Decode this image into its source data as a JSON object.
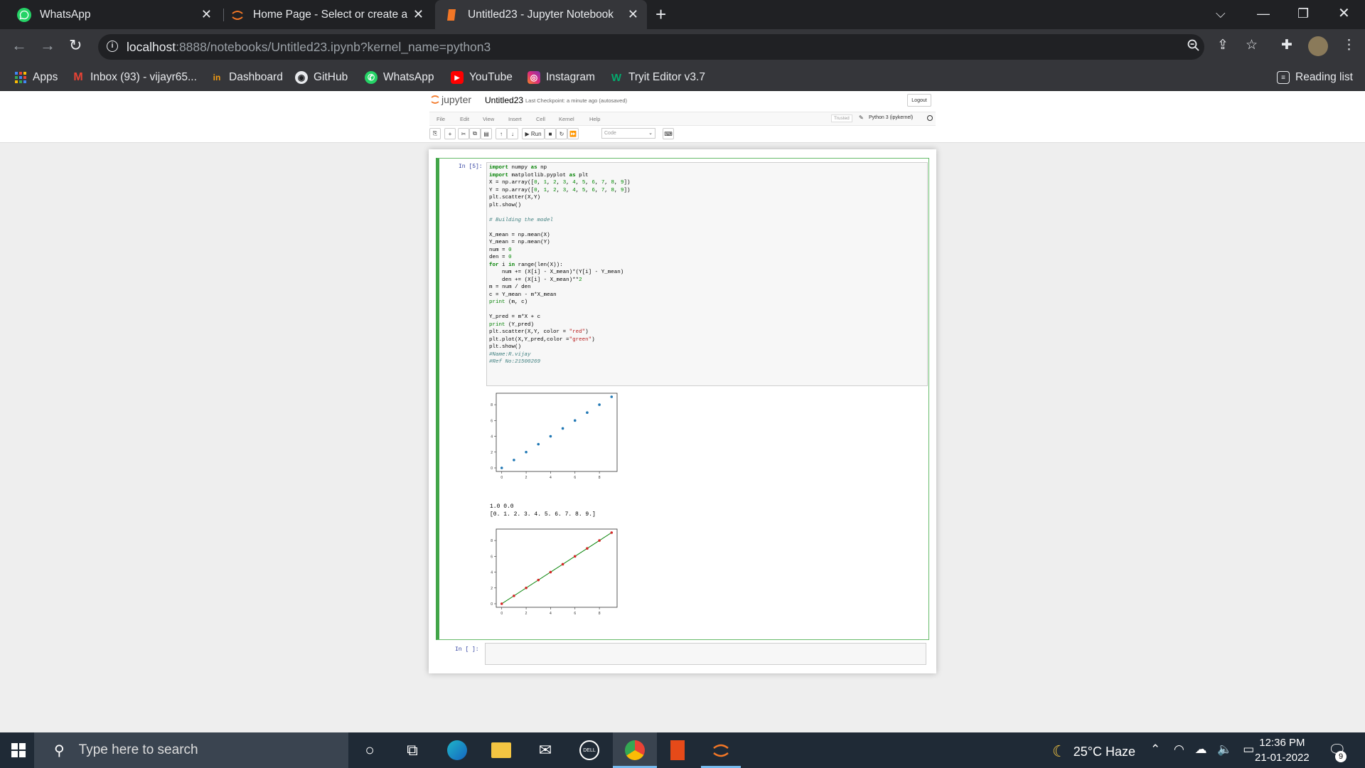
{
  "browser": {
    "tabs": [
      {
        "title": "WhatsApp",
        "icon": "whatsapp-icon"
      },
      {
        "title": "Home Page - Select or create a n",
        "icon": "jupyter-icon"
      },
      {
        "title": "Untitled23 - Jupyter Notebook",
        "icon": "jupyter-notebook-icon"
      }
    ],
    "url_host": "localhost",
    "url_path": ":8888/notebooks/Untitled23.ipynb?kernel_name=python3",
    "bookmarks": [
      {
        "label": "Apps",
        "icon": "apps-grid-icon"
      },
      {
        "label": "Inbox (93) - vijayr65...",
        "icon": "gmail-icon"
      },
      {
        "label": "Dashboard",
        "icon": "dashboard-icon"
      },
      {
        "label": "GitHub",
        "icon": "github-icon"
      },
      {
        "label": "WhatsApp",
        "icon": "whatsapp-icon"
      },
      {
        "label": "YouTube",
        "icon": "youtube-icon"
      },
      {
        "label": "Instagram",
        "icon": "instagram-icon"
      },
      {
        "label": "Tryit Editor v3.7",
        "icon": "w3schools-icon"
      }
    ],
    "reading_list": "Reading list"
  },
  "jupyter": {
    "logo_text": "jupyter",
    "notebook_name": "Untitled23",
    "checkpoint": "Last Checkpoint: a minute ago  (autosaved)",
    "logout": "Logout",
    "menus": [
      "File",
      "Edit",
      "View",
      "Insert",
      "Cell",
      "Kernel",
      "Help"
    ],
    "trusted": "Trusted",
    "kernel": "Python 3 (ipykernel)",
    "run_label": "Run",
    "cell_type": "Code"
  },
  "cells": {
    "prompt1": "In [5]:",
    "code_lines": [
      "import numpy as np",
      "import matplotlib.pyplot as plt",
      "X = np.array([0, 1, 2, 3, 4, 5, 6, 7, 8, 9])",
      "Y = np.array([0, 1, 2, 3, 4, 5, 6, 7, 8, 9])",
      "plt.scatter(X,Y)",
      "plt.show()",
      "",
      "# Building the model",
      "",
      "X_mean = np.mean(X)",
      "Y_mean = np.mean(Y)",
      "num = 0",
      "den = 0",
      "for i in range(len(X)):",
      "    num += (X[i] - X_mean)*(Y[i] - Y_mean)",
      "    den += (X[i] - X_mean)**2",
      "m = num / den",
      "c = Y_mean - m*X_mean",
      "print (m, c)",
      "",
      "Y_pred = m*X + c",
      "print (Y_pred)",
      "plt.scatter(X,Y, color = \"red\")",
      "plt.plot(X,Y_pred,color =\"green\")",
      "plt.show()",
      "#Name:R.vijay",
      "#Ref No:21500269"
    ],
    "print_mc": "1.0 0.0",
    "print_pred": "[0. 1. 2. 3. 4. 5. 6. 7. 8. 9.]",
    "prompt2": "In [ ]:"
  },
  "chart_data": [
    {
      "type": "scatter",
      "x": [
        0,
        1,
        2,
        3,
        4,
        5,
        6,
        7,
        8,
        9
      ],
      "y": [
        0,
        1,
        2,
        3,
        4,
        5,
        6,
        7,
        8,
        9
      ],
      "color": "#1f77b4",
      "xticks": [
        "0",
        "2",
        "4",
        "6",
        "8"
      ],
      "yticks": [
        "0",
        "2",
        "4",
        "6",
        "8"
      ],
      "xlim": [
        -0.45,
        9.45
      ],
      "ylim": [
        -0.45,
        9.45
      ]
    },
    {
      "type": "scatter",
      "x": [
        0,
        1,
        2,
        3,
        4,
        5,
        6,
        7,
        8,
        9
      ],
      "y": [
        0,
        1,
        2,
        3,
        4,
        5,
        6,
        7,
        8,
        9
      ],
      "color": "#d62728",
      "line": {
        "x": [
          0,
          9
        ],
        "y": [
          0,
          9
        ],
        "color": "#008000"
      },
      "xticks": [
        "0",
        "2",
        "4",
        "6",
        "8"
      ],
      "yticks": [
        "0",
        "2",
        "4",
        "6",
        "8"
      ],
      "xlim": [
        -0.45,
        9.45
      ],
      "ylim": [
        -0.45,
        9.45
      ]
    }
  ],
  "taskbar": {
    "search_placeholder": "Type here to search",
    "weather": "25°C  Haze",
    "time": "12:36 PM",
    "date": "21-01-2022",
    "notifications": "9"
  }
}
